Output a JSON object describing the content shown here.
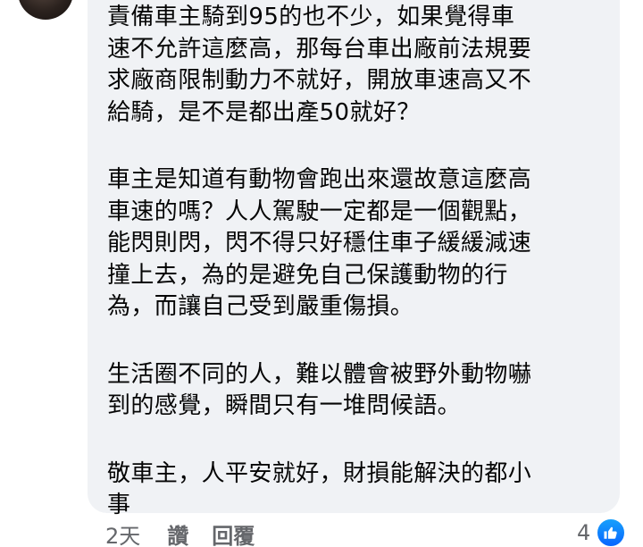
{
  "comment": {
    "paragraphs": [
      {
        "lines": [
          "責備車主騎到95的也不少，如果覺得車",
          "速不允許這麼高，那每台車出廠前法規要",
          "求廠商限制動力不就好，開放車速高又不",
          "給騎，是不是都出產50就好？"
        ]
      },
      {
        "lines": [
          "車主是知道有動物會跑出來還故意這麼高",
          "車速的嗎？人人駕駛一定都是一個觀點，",
          "能閃則閃，閃不得只好穩住車子緩緩減速",
          "撞上去，為的是避免自己保護動物的行",
          "為，而讓自己受到嚴重傷損。"
        ]
      },
      {
        "lines": [
          "生活圈不同的人，難以體會被野外動物嚇",
          "到的感覺，瞬間只有一堆問候語。"
        ]
      },
      {
        "lines": [
          "敬車主，人平安就好，財損能解決的都小",
          "事"
        ]
      }
    ]
  },
  "actions": {
    "time": "2天",
    "like_label": "讚",
    "reply_label": "回覆"
  },
  "reactions": {
    "count": "4",
    "icon": "thumbs-up-icon",
    "badge_color": "#0866ff"
  }
}
